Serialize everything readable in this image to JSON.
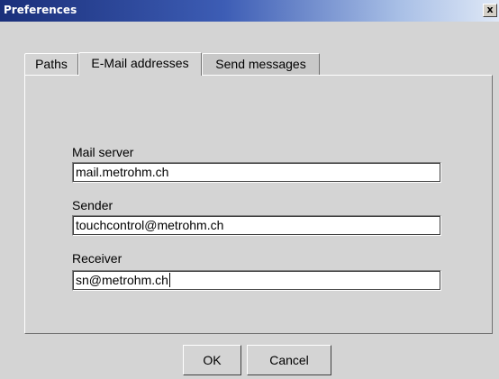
{
  "window": {
    "title": "Preferences",
    "close_label": "x"
  },
  "tabs": [
    {
      "label": "Paths",
      "selected": false
    },
    {
      "label": "E-Mail addresses",
      "selected": true
    },
    {
      "label": "Send messages",
      "selected": false
    }
  ],
  "form": {
    "mail_server": {
      "label": "Mail server",
      "value": "mail.metrohm.ch"
    },
    "sender": {
      "label": "Sender",
      "value": "touchcontrol@metrohm.ch"
    },
    "receiver": {
      "label": "Receiver",
      "value": "sn@metrohm.ch"
    }
  },
  "buttons": {
    "ok": "OK",
    "cancel": "Cancel"
  },
  "colors": {
    "title_gradient_start": "#1a2f7a",
    "title_gradient_end": "#dfe8f6",
    "window_bg": "#d4d4d4"
  }
}
